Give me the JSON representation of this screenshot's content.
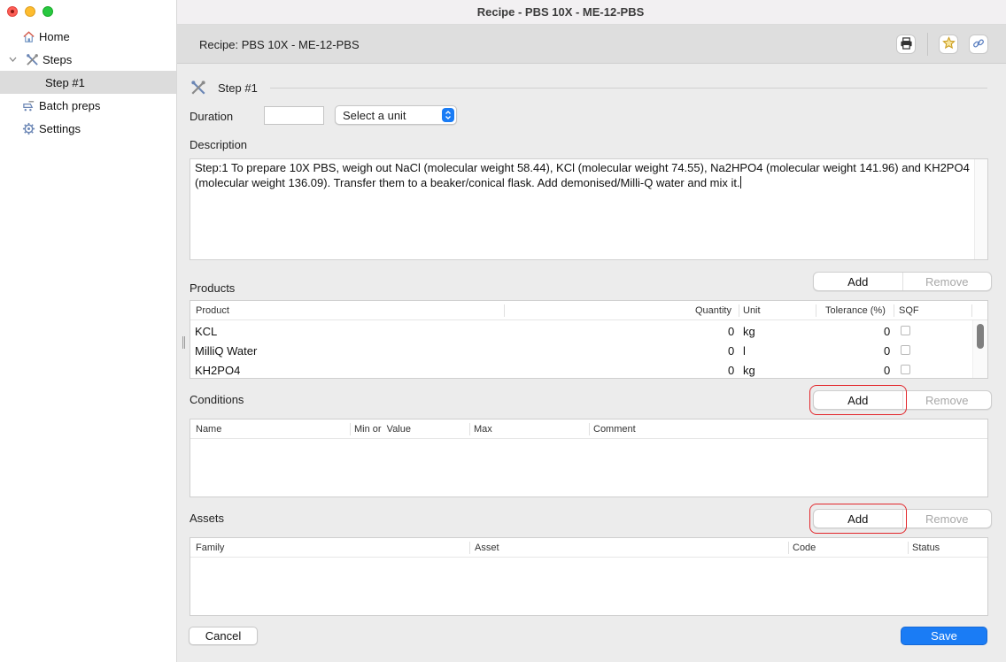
{
  "window": {
    "title": "Recipe - PBS 10X - ME-12-PBS"
  },
  "sidebar": {
    "items": [
      {
        "label": "Home",
        "icon": "home-icon"
      },
      {
        "label": "Steps",
        "icon": "tools-icon"
      },
      {
        "label": "Step #1"
      },
      {
        "label": "Batch preps",
        "icon": "batch-icon"
      },
      {
        "label": "Settings",
        "icon": "gear-icon"
      }
    ]
  },
  "header": {
    "title": "Recipe: PBS 10X - ME-12-PBS"
  },
  "step": {
    "title": "Step #1",
    "duration_label": "Duration",
    "duration_value": "",
    "unit_select": "Select a unit",
    "description_label": "Description",
    "description_text": "Step:1 To prepare 10X PBS, weigh out NaCl (molecular weight 58.44), KCl (molecular weight 74.55), Na2HPO4 (molecular weight 141.96) and KH2PO4 (molecular weight 136.09). Transfer them to a beaker/conical flask. Add demonised/Milli-Q water and mix it."
  },
  "products": {
    "label": "Products",
    "add": "Add",
    "remove": "Remove",
    "columns": [
      "Product",
      "Quantity",
      "Unit",
      "Tolerance (%)",
      "SQF"
    ],
    "rows": [
      {
        "product": "KCL",
        "quantity": "0",
        "unit": "kg",
        "tolerance": "0"
      },
      {
        "product": "MilliQ Water",
        "quantity": "0",
        "unit": "l",
        "tolerance": "0"
      },
      {
        "product": "KH2PO4",
        "quantity": "0",
        "unit": "kg",
        "tolerance": "0"
      }
    ]
  },
  "conditions": {
    "label": "Conditions",
    "add": "Add",
    "remove": "Remove",
    "columns": [
      "Name",
      "Min or  Value",
      "Max",
      "Comment"
    ]
  },
  "assets": {
    "label": "Assets",
    "add": "Add",
    "remove": "Remove",
    "columns": [
      "Family",
      "Asset",
      "Code",
      "Status"
    ]
  },
  "footer": {
    "cancel": "Cancel",
    "save": "Save"
  },
  "colors": {
    "accent": "#1a7cf5",
    "highlight": "#e2262b"
  }
}
